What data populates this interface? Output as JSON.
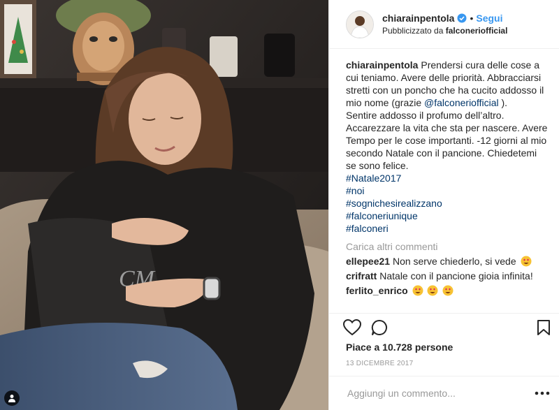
{
  "header": {
    "username": "chiarainpentola",
    "separator": "•",
    "follow_label": "Segui",
    "sponsored_prefix": "Pubblicizzato da",
    "sponsor": "falconeriofficial"
  },
  "caption": {
    "username": "chiarainpentola",
    "text_1": "Prendersi cura delle cose a cui teniamo. Avere delle priorità. Abbracciarsi stretti con un poncho che ha cucito addosso il mio nome (grazie",
    "mention": "@falconeriofficial",
    "text_2": ").",
    "text_3": "Sentire addosso il profumo dell’altro. Accarezzare la vita che sta per nascere. Avere Tempo per le cose importanti. -12 giorni al mio secondo Natale con il pancione. Chiedetemi se sono felice.",
    "hashtags": [
      "#Natale2017",
      "#noi",
      "#sognichesirealizzano",
      "#falconeriunique",
      "#falconeri"
    ]
  },
  "load_more": "Carica altri commenti",
  "comments": [
    {
      "user": "ellepee21",
      "text": "Non serve chiederlo, si vede",
      "emojis": 1
    },
    {
      "user": "crifratt",
      "text": "Natale con il pancione gioia infinita!",
      "emojis": 0
    },
    {
      "user": "ferlito_enrico",
      "text": "",
      "emojis": 3
    }
  ],
  "likes": "Piace a 10.728 persone",
  "date": "13 DICEMBRE 2017",
  "add_comment": {
    "placeholder": "Aggiungi un commento..."
  },
  "icons": {
    "like": "heart-icon",
    "comment": "comment-icon",
    "save": "bookmark-icon",
    "verified": "verified-badge-icon",
    "tag": "person-tag-icon",
    "more": "more-options-icon"
  },
  "colors": {
    "link": "#3897f0",
    "hashtag": "#003569",
    "muted": "#999999",
    "text": "#262626"
  },
  "photo": {
    "monogram": "CM"
  }
}
